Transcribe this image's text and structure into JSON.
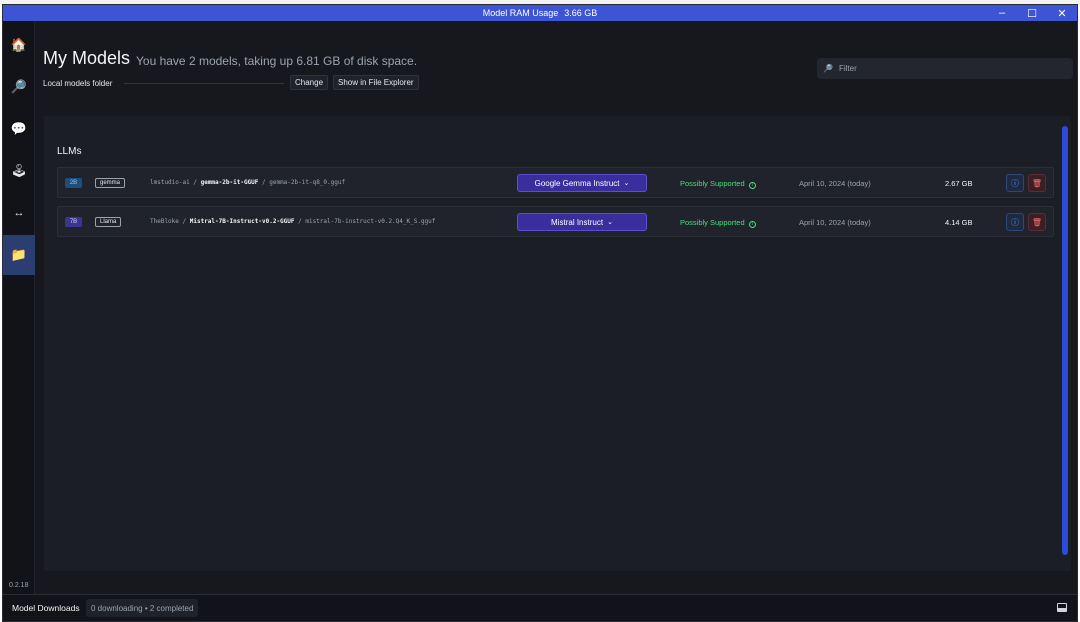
{
  "window": {
    "title": "Model RAM Usage",
    "ram_value": "3.66 GB"
  },
  "window_controls": {
    "minimize": "–",
    "maximize": "☐",
    "close": "✕"
  },
  "sidebar": {
    "items": [
      {
        "icon": "home-icon",
        "glyph": "🏠"
      },
      {
        "icon": "search-icon",
        "glyph": "🔎"
      },
      {
        "icon": "chat-icon",
        "glyph": "💬"
      },
      {
        "icon": "joystick-icon",
        "glyph": "🕹"
      },
      {
        "icon": "arrows-horizontal-icon",
        "glyph": "↔"
      },
      {
        "icon": "folder-icon",
        "glyph": "📁"
      }
    ],
    "version": "0.2.18"
  },
  "header": {
    "title": "My Models",
    "subtitle": "You have 2 models, taking up 6.81 GB of disk space.",
    "folder_label": "Local models folder",
    "change_label": "Change",
    "show_explorer_label": "Show in File Explorer"
  },
  "filter": {
    "placeholder": "Filter"
  },
  "section": {
    "title": "LLMs"
  },
  "models": [
    {
      "size_badge": "2B",
      "arch": "gemma",
      "publisher": "lmstudio-ai",
      "repo": "gemma-2b-it-GGUF",
      "file": "gemma-2b-it-q8_0.gguf",
      "preset": "Google Gemma Instruct",
      "status": "Possibly Supported",
      "date": "April 10, 2024 (today)",
      "file_size": "2.67 GB"
    },
    {
      "size_badge": "7B",
      "arch": "Llama",
      "publisher": "TheBloke",
      "repo": "Mistral-7B-Instruct-v0.2-GGUF",
      "file": "mistral-7b-instruct-v0.2.Q4_K_S.gguf",
      "preset": "Mistral Instruct",
      "status": "Possibly Supported",
      "date": "April 10, 2024 (today)",
      "file_size": "4.14 GB"
    }
  ],
  "bottom": {
    "downloads_label": "Model Downloads",
    "downloads_status": "0 downloading • 2 completed"
  },
  "colors": {
    "accent": "#3d55d4",
    "preset_button": "#3a2e9e",
    "supported": "#4ade80",
    "size_2b": "#1e4e79",
    "size_7b": "#3b3490"
  }
}
